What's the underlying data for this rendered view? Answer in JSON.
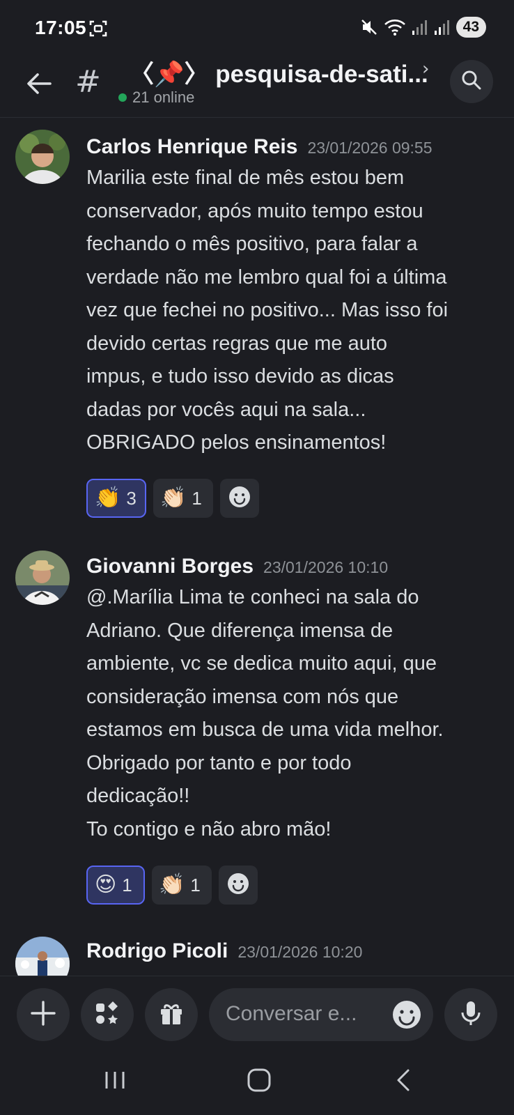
{
  "status_bar": {
    "time": "17:05",
    "battery": "43",
    "icons": [
      "screenshot-icon",
      "mute-icon",
      "wifi-icon",
      "signal-icon",
      "signal-icon"
    ]
  },
  "header": {
    "channel_name": "〈📌〉 pesquisa-de-sati...",
    "online_text": "21 online"
  },
  "messages": [
    {
      "author": "Carlos Henrique Reis",
      "timestamp": "23/01/2026 09:55",
      "content": "Marilia este final de mês estou bem\nconservador, após muito tempo estou\nfechando o mês positivo, para falar a\nverdade não me lembro qual foi a última\nvez que fechei no positivo... Mas isso foi\ndevido certas regras que me auto\nimpus, e tudo isso devido as dicas\ndadas por vocês aqui na sala...\nOBRIGADO pelos ensinamentos!",
      "reactions": [
        {
          "emoji": "👏",
          "count": "3"
        },
        {
          "emoji": "👏🏻",
          "count": "1"
        }
      ]
    },
    {
      "author": "Giovanni Borges",
      "timestamp": "23/01/2026 10:10",
      "content": "@.Marília Lima  te conheci na sala do\nAdriano. Que diferença imensa de\nambiente, vc se dedica muito aqui, que\nconsideração imensa com nós que\nestamos em busca de uma vida melhor.\nObrigado por tanto e por todo\ndedicação!!\nTo contigo e não abro mão!",
      "reactions": [
        {
          "emoji": "😍",
          "count": "1"
        },
        {
          "emoji": "👏🏻",
          "count": "1"
        }
      ]
    },
    {
      "author": "Rodrigo Picoli",
      "timestamp": "23/01/2026 10:20"
    }
  ],
  "composer": {
    "placeholder": "Conversar e..."
  },
  "colors": {
    "background": "#1c1d22",
    "surface": "#2b2d33",
    "accent": "#5865f2",
    "online": "#23a55a"
  }
}
